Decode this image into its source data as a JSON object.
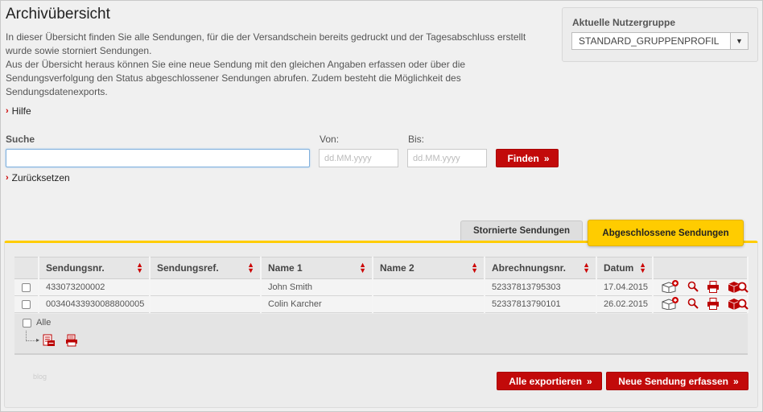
{
  "page": {
    "title": "Archivübersicht",
    "intro_lines": [
      "In dieser Übersicht finden Sie alle Sendungen, für die der Versandschein bereits gedruckt und der Tagesabschluss erstellt",
      "wurde sowie storniert Sendungen.",
      "Aus der Übersicht heraus können Sie eine neue Sendung mit den gleichen Angaben erfassen oder über die",
      "Sendungsverfolgung den Status abgeschlossener Sendungen abrufen. Zudem besteht die Möglichkeit des",
      "Sendungsdatenexports."
    ],
    "help_link": "Hilfe"
  },
  "user_group": {
    "label": "Aktuelle Nutzergruppe",
    "selected": "STANDARD_GRUPPENPROFIL"
  },
  "search": {
    "label": "Suche",
    "value": "",
    "from_label": "Von:",
    "from_placeholder": "dd.MM.yyyy",
    "to_label": "Bis:",
    "to_placeholder": "dd.MM.yyyy",
    "find_button": "Finden",
    "reset_link": "Zurücksetzen"
  },
  "tabs": [
    {
      "label": "Stornierte Sendungen",
      "active": false
    },
    {
      "label": "Abgeschlossene Sendungen",
      "active": true
    }
  ],
  "table": {
    "columns": [
      "Sendungsnr.",
      "Sendungsref.",
      "Name 1",
      "Name 2",
      "Abrechnungsnr.",
      "Datum"
    ],
    "rows": [
      {
        "sendungsnr": "433073200002",
        "sendungsref": "",
        "name1": "John Smith",
        "name2": "",
        "abrechnungsnr": "52337813795303",
        "datum": "17.04.2015"
      },
      {
        "sendungsnr": "00340433930088800005",
        "sendungsref": "",
        "name1": "Colin Karcher",
        "name2": "",
        "abrechnungsnr": "52337813790101",
        "datum": "26.02.2015"
      }
    ],
    "select_all": "Alle"
  },
  "footer": {
    "small_text": "blog",
    "export_all_button": "Alle exportieren",
    "new_shipment_button": "Neue Sendung erfassen"
  },
  "colors": {
    "accent_red": "#c20a0a",
    "tab_yellow": "#ffcc00"
  }
}
